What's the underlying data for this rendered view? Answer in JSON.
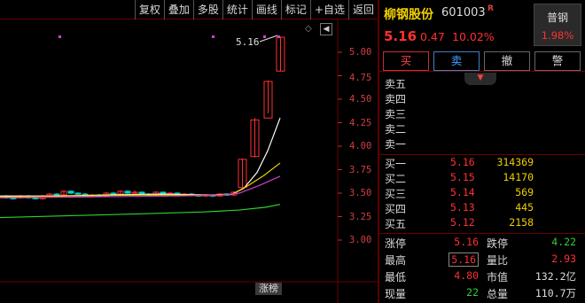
{
  "toolbar": {
    "buttons": [
      "复权",
      "叠加",
      "多股",
      "统计",
      "画线",
      "标记",
      "+自选",
      "返回"
    ]
  },
  "chart": {
    "y_ticks": [
      "5.00",
      "4.75",
      "4.50",
      "4.25",
      "4.00",
      "3.75",
      "3.50",
      "3.25",
      "3.00"
    ],
    "last_price_label": "5.16",
    "bottom_tag": "涨榜",
    "colors": {
      "up": "#ff3030",
      "down": "#00d0d0",
      "ma5": "#ffffff",
      "ma10": "#f0d000",
      "ma20": "#d040d0",
      "ma60": "#30d030"
    }
  },
  "stock": {
    "name": "柳钢股份",
    "code": "601003",
    "flag": "R",
    "price": "5.16",
    "change": "0.47",
    "change_pct": "10.02%",
    "sector": "普钢",
    "sector_pct": "1.98%"
  },
  "actions": [
    "买",
    "卖",
    "撤",
    "警"
  ],
  "collapse_icon": "chevron-down-icon",
  "asks": [
    {
      "label": "卖五",
      "price": "",
      "vol": ""
    },
    {
      "label": "卖四",
      "price": "",
      "vol": ""
    },
    {
      "label": "卖三",
      "price": "",
      "vol": ""
    },
    {
      "label": "卖二",
      "price": "",
      "vol": ""
    },
    {
      "label": "卖一",
      "price": "",
      "vol": ""
    }
  ],
  "bids": [
    {
      "label": "买一",
      "price": "5.16",
      "vol": "314369"
    },
    {
      "label": "买二",
      "price": "5.15",
      "vol": "14170"
    },
    {
      "label": "买三",
      "price": "5.14",
      "vol": "569"
    },
    {
      "label": "买四",
      "price": "5.13",
      "vol": "445"
    },
    {
      "label": "买五",
      "price": "5.12",
      "vol": "2158"
    }
  ],
  "stats": [
    {
      "k1": "涨停",
      "v1": "5.16",
      "k2": "跌停",
      "v2": "4.22"
    },
    {
      "k1": "最高",
      "v1": "5.16",
      "k2": "量比",
      "v2": "2.93"
    },
    {
      "k1": "最低",
      "v1": "4.80",
      "k2": "市值",
      "v2": "132.2亿"
    },
    {
      "k1": "现量",
      "v1": "22",
      "k2": "总量",
      "v2": "110.7万"
    }
  ]
}
